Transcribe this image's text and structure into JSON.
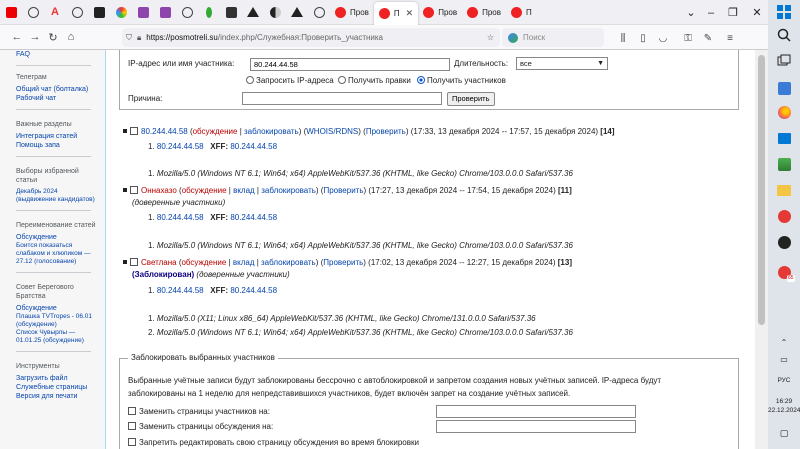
{
  "tabs": [
    {
      "label": "Пров",
      "active": false
    },
    {
      "label": "П",
      "active": true
    },
    {
      "label": "Пров",
      "active": false
    },
    {
      "label": "Пров",
      "active": false
    },
    {
      "label": "П",
      "active": false
    }
  ],
  "navbar": {
    "url_host": "https://posmotreli.su",
    "url_path": "/index.php/Служебная:Проверить_участника",
    "search_placeholder": "Поиск"
  },
  "sidebar": {
    "faq": "FAQ",
    "telegram_head": "Телеграм",
    "telegram_items": [
      "Общий чат (болталка)",
      "Рабочий чат"
    ],
    "important_head": "Важные разделы",
    "important_items": [
      "Интеграция статей",
      "Помощь запа"
    ],
    "elections_head": "Выборы избранной статьи",
    "elections_item": "Декабрь 2024 (выдвижение кандидатов)",
    "rename_head": "Переименование статей",
    "rename_items": [
      "Обсуждение",
      "Боится показаться слабаком и хлюпиком — 27.12 (голосование)"
    ],
    "council_head": "Совет Берегового Братства",
    "council_items": [
      "Обсуждение",
      "Плашка TVTropes - 06.01 (обсуждение)",
      "Список Чувырлы — 01.01.25 (обсуждение)"
    ],
    "tools_head": "Инструменты",
    "tools_items": [
      "Загрузить файл",
      "Служебные страницы",
      "Версия для печати"
    ]
  },
  "form": {
    "ip_label": "IP-адрес или имя участника:",
    "ip_value": "80.244.44.58",
    "duration_label": "Длительность:",
    "duration_value": "все",
    "radio_1": "Запросить IP-адреса",
    "radio_2": "Получить правки",
    "radio_3": "Получить участников",
    "reason_label": "Причина:",
    "reason_value": "",
    "submit": "Проверить"
  },
  "results": {
    "e1": {
      "name": "80.244.44.58",
      "talk": "обсуждение",
      "sep": "|",
      "block": "заблокировать",
      "whois": "WHOIS/RDNS",
      "check": "Проверить",
      "period": "(17:33, 13 декабря 2024 -- 17:57, 15 декабря 2024)",
      "count": "[14]",
      "ip_num": "1.",
      "ip": "80.244.44.58",
      "xff": "XFF:",
      "xff_ip": "80.244.44.58",
      "ua_num": "1.",
      "ua": "Mozilla/5.0 (Windows NT 6.1; Win64; x64) AppleWebKit/537.36 (KHTML, like Gecko) Chrome/103.0.0.0 Safari/537.36"
    },
    "e2": {
      "name": "Оннахазо",
      "talk": "обсуждение",
      "contrib": "вклад",
      "block": "заблокировать",
      "check": "Проверить",
      "period": "(17:27, 13 декабря 2024 -- 17:54, 15 декабря 2024)",
      "count": "[11]",
      "group": "(доверенные участники)",
      "ip_num": "1.",
      "ip": "80.244.44.58",
      "xff": "XFF:",
      "xff_ip": "80.244.44.58",
      "ua_num": "1.",
      "ua": "Mozilla/5.0 (Windows NT 6.1; Win64; x64) AppleWebKit/537.36 (KHTML, like Gecko) Chrome/103.0.0.0 Safari/537.36"
    },
    "e3": {
      "name": "Светлана",
      "talk": "обсуждение",
      "contrib": "вклад",
      "block": "заблокировать",
      "check": "Проверить",
      "period": "(17:02, 13 декабря 2024 -- 12:27, 15 декабря 2024)",
      "count": "[13]",
      "blocked": "(Заблокирован)",
      "group": "(доверенные участники)",
      "ip_num": "1.",
      "ip": "80.244.44.58",
      "xff": "XFF:",
      "xff_ip": "80.244.44.58",
      "ua1_num": "1.",
      "ua1": "Mozilla/5.0 (X11; Linux x86_64) AppleWebKit/537.36 (KHTML, like Gecko) Chrome/131.0.0.0 Safari/537.36",
      "ua2_num": "2.",
      "ua2": "Mozilla/5.0 (Windows NT 6.1; Win64; x64) AppleWebKit/537.36 (KHTML, like Gecko) Chrome/103.0.0.0 Safari/537.36"
    }
  },
  "block_form": {
    "legend": "Заблокировать выбранных участников",
    "desc_1": "Выбранные учётные записи будут заблокированы бессрочно с автоблокировкой и запретом создания новых учётных записей. IP-адреса будут",
    "desc_2": "заблокированы на 1 неделю для непредставившихся участников, будет включён запрет на создание учётных записей.",
    "opt_1": "Заменить страницы участников на:",
    "opt_2": "Заменить страницы обсуждения на:",
    "opt_3": "Запретить редактировать свою страницу обсуждения во время блокировки"
  },
  "taskbar": {
    "lang": "РУС",
    "time": "16:29",
    "date": "22.12.2024",
    "badge": "65"
  }
}
